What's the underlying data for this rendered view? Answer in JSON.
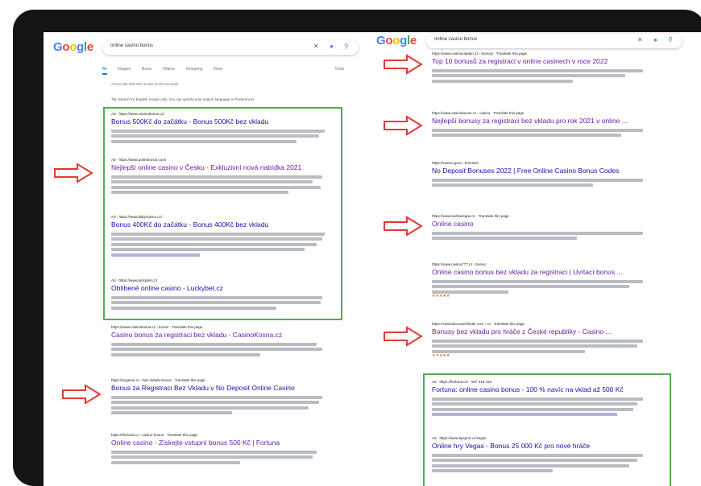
{
  "colors": {
    "accent_arrow": "#e53935",
    "highlight_box": "#4caf50",
    "link": "#1a0dab",
    "link_visited": "#681da8"
  },
  "left": {
    "logo": "Google",
    "query": "online casino bonus",
    "tabs": [
      "All",
      "Images",
      "News",
      "Videos",
      "Shopping",
      "More",
      "Tools"
    ],
    "stats": "About 105 000 000 results (0.38 seconds)",
    "lang_notice": "Tip: Search for English results only. You can specify your search language in Preferences",
    "results": [
      {
        "url": "Ad · https://www.casinobonus.cz/",
        "title": "Bonus 500Kč do začátku - Bonus 500Kč bez vkladu",
        "ad": true
      },
      {
        "url": "Ad · https://www.pokerbonus.com/",
        "title": "Nejlepší online casino v Česku - Exkluzivní nová nabídka 2021",
        "ad": true,
        "visited": true
      },
      {
        "url": "Ad · https://www.tiktipcasino.cz/",
        "title": "Bonus 400Kč do začátku - Bonus 400Kč bez vkladu",
        "ad": true
      },
      {
        "url": "Ad · https://www.luckybet.cz/",
        "title": "Oblíbené online casino - Luckybet.cz",
        "ad": true
      },
      {
        "url": "https://www.casinokosna.cz › bonus · Translate this page",
        "title": "Casino bonus za registraci bez vkladu - CasinoKosna.cz"
      },
      {
        "url": "https://kogame.cz › bez-vkladu-bonus · Translate this page",
        "title": "Bonus za Registraci Bez Vkladu v No Deposit Online Casino"
      },
      {
        "url": "https://ifortuna.cz › casino-bonus · Translate this page",
        "title": "Online casino - Získejte vstupní bonus 500 Kč | Fortuna"
      }
    ]
  },
  "right": {
    "logo": "Google",
    "query": "online casino bonus",
    "results": [
      {
        "url": "https://www.casinocaptain.cz › bonusy · Translate this page",
        "title": "Top 10 bonusů za registraci v online casinech v roce 2022"
      },
      {
        "url": "https://www.casinobonus.cz › casino · Translate this page",
        "title": "Nejlepší bonusy za registraci bez vkladu pro rok 2021 v online ..."
      },
      {
        "url": "https://casino.guru › bonuses",
        "title": "No Deposit Bonuses 2022 | Free Online Casino Bonus Codes"
      },
      {
        "url": "https://www.sazkavegas.cz · Translate this page",
        "title": "Online casino"
      },
      {
        "url": "https://www.casino777.cz › bonus",
        "title": "Online casino bonus bez vkladu za registraci | Uvítací bonus ..."
      },
      {
        "url": "https://casinobonusesfinder.com › cs · Translate this page",
        "title": "Bonusy bez vkladu pro hráče z České republiky - Casino ..."
      },
      {
        "url": "Ad · https://ifortuna.cz/ · 557 318 318",
        "title": "Fortuna: online casino bonus - 100 % navíc na vklad až 500 Kč",
        "ad": true
      },
      {
        "url": "Ad · https://www.tipsport.cz/vegas",
        "title": "Online hry Vegas - Bonus 25 000 Kč pro nové hráče",
        "ad": true
      }
    ]
  }
}
